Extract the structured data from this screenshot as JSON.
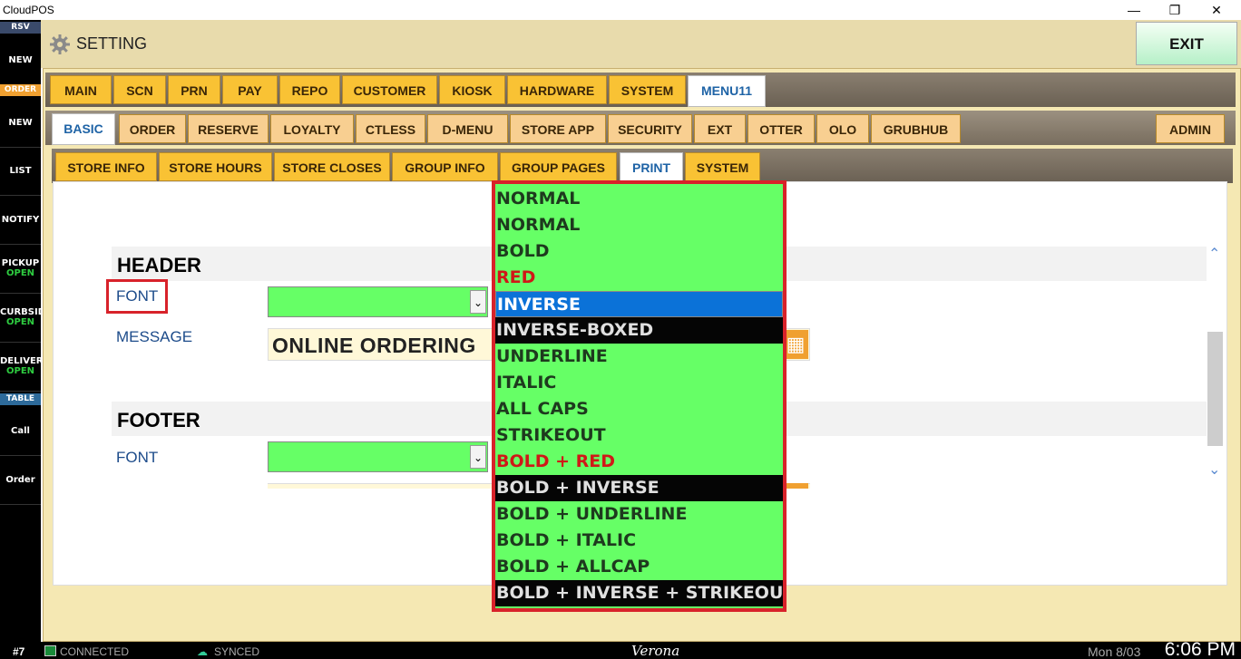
{
  "window": {
    "title": "CloudPOS",
    "minimize": "—",
    "maximize": "❐",
    "close": "✕"
  },
  "sidebar": {
    "tag_rsv": "RSV",
    "tag_order": "ORDER",
    "tag_table": "TABLE",
    "items": [
      {
        "label": "NEW",
        "sub": ""
      },
      {
        "label": "NEW",
        "sub": ""
      },
      {
        "label": "LIST",
        "sub": ""
      },
      {
        "label": "NOTIFY",
        "sub": ""
      },
      {
        "label": "PICKUP",
        "sub": "OPEN"
      },
      {
        "label": "CURBSID",
        "sub": "OPEN"
      },
      {
        "label": "DELIVERY",
        "sub": "OPEN"
      },
      {
        "label": "Call",
        "sub": ""
      },
      {
        "label": "Order",
        "sub": ""
      }
    ]
  },
  "header": {
    "title": "SETTING",
    "exit_label": "EXIT"
  },
  "tabs_main": [
    "MAIN",
    "SCN",
    "PRN",
    "PAY",
    "REPO",
    "CUSTOMER",
    "KIOSK",
    "HARDWARE",
    "SYSTEM",
    "MENU11"
  ],
  "tabs_sub": [
    "BASIC",
    "ORDER",
    "RESERVE",
    "LOYALTY",
    "CTLESS",
    "D-MENU",
    "STORE APP",
    "SECURITY",
    "EXT",
    "OTTER",
    "OLO",
    "GRUBHUB",
    "ADMIN"
  ],
  "tabs_third": [
    "STORE INFO",
    "STORE HOURS",
    "STORE CLOSES",
    "GROUP INFO",
    "GROUP PAGES",
    "PRINT",
    "SYSTEM"
  ],
  "content": {
    "header_section": {
      "title": "HEADER",
      "font_label": "FONT",
      "message_label": "MESSAGE",
      "message_value": "ONLINE ORDERING"
    },
    "footer_section": {
      "title": "FOOTER",
      "font_label": "FONT"
    }
  },
  "dropdown": {
    "options": [
      "NORMAL",
      "NORMAL",
      "BOLD",
      "RED",
      "INVERSE",
      "INVERSE-BOXED",
      "UNDERLINE",
      "ITALIC",
      "ALL CAPS",
      "STRIKEOUT",
      "BOLD + RED",
      "BOLD + INVERSE",
      "BOLD + UNDERLINE",
      "BOLD + ITALIC",
      "BOLD + ALLCAP",
      "BOLD + INVERSE + STRIKEOUT"
    ],
    "selected": "INVERSE"
  },
  "status": {
    "station": "#7",
    "connection": "CONNECTED",
    "sync": "SYNCED",
    "store": "Verona",
    "date": "Mon 8/03",
    "time": "6:06 PM"
  },
  "colors": {
    "accent_tab": "#f9c234",
    "selection": "#0b72d8",
    "highlight": "#d8222a",
    "option_bg": "#66ff66"
  }
}
